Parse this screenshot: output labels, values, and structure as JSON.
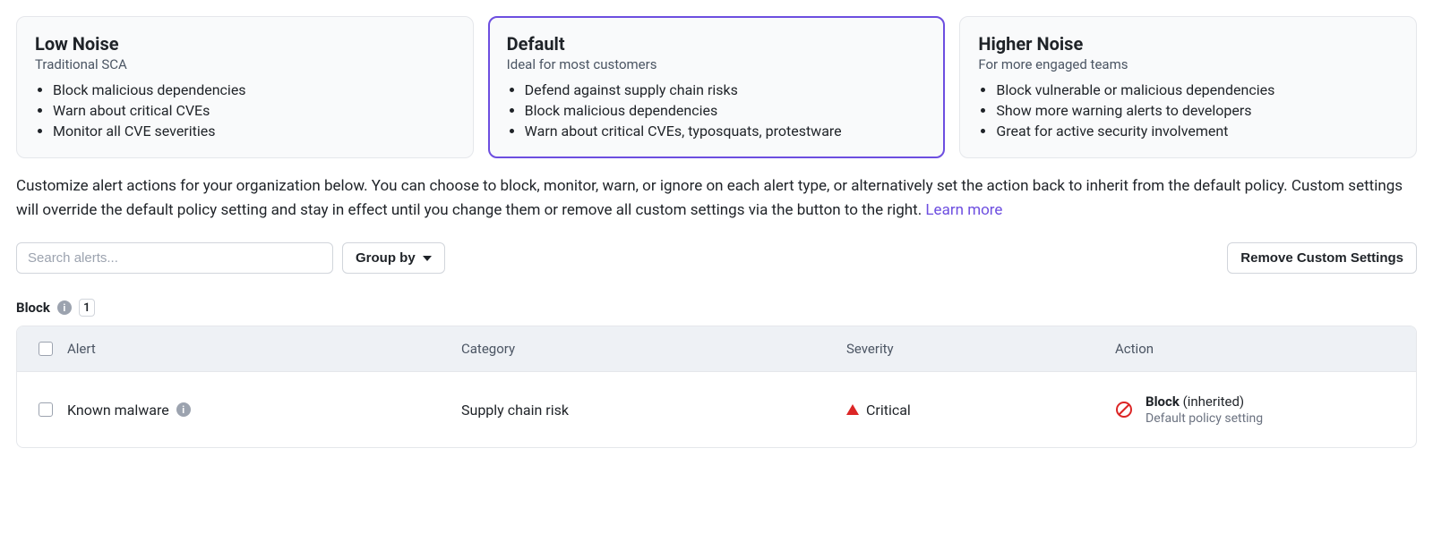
{
  "policies": [
    {
      "title": "Low Noise",
      "subtitle": "Traditional SCA",
      "bullets": [
        "Block malicious dependencies",
        "Warn about critical CVEs",
        "Monitor all CVE severities"
      ],
      "selected": false
    },
    {
      "title": "Default",
      "subtitle": "Ideal for most customers",
      "bullets": [
        "Defend against supply chain risks",
        "Block malicious dependencies",
        "Warn about critical CVEs, typosquats, protestware"
      ],
      "selected": true
    },
    {
      "title": "Higher Noise",
      "subtitle": "For more engaged teams",
      "bullets": [
        "Block vulnerable or malicious dependencies",
        "Show more warning alerts to developers",
        "Great for active security involvement"
      ],
      "selected": false
    }
  ],
  "description": "Customize alert actions for your organization below. You can choose to block, monitor, warn, or ignore on each alert type, or alternatively set the action back to inherit from the default policy. Custom settings will override the default policy setting and stay in effect until you change them or remove all custom settings via the button to the right.",
  "learn_more": "Learn more",
  "search": {
    "placeholder": "Search alerts..."
  },
  "group_by_label": "Group by",
  "remove_custom_label": "Remove Custom Settings",
  "section": {
    "label": "Block",
    "count": "1"
  },
  "table": {
    "headers": {
      "alert": "Alert",
      "category": "Category",
      "severity": "Severity",
      "action": "Action"
    },
    "rows": [
      {
        "alert": "Known malware",
        "category": "Supply chain risk",
        "severity": "Critical",
        "action_label": "Block",
        "action_suffix": "(inherited)",
        "action_sub": "Default policy setting"
      }
    ]
  }
}
